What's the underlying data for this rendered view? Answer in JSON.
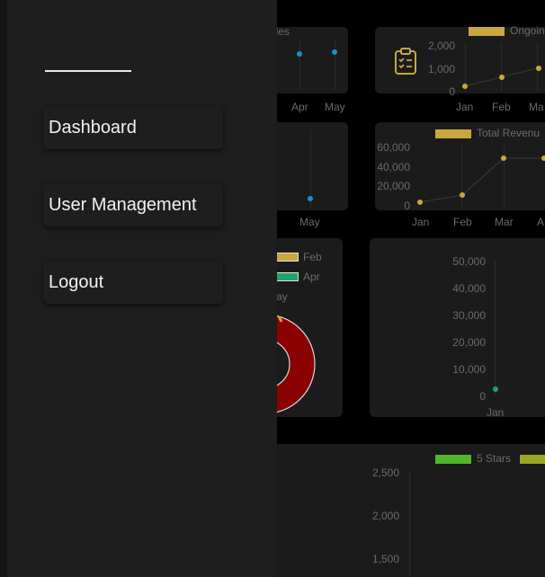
{
  "drawer": {
    "items": [
      {
        "label": "Dashboard"
      },
      {
        "label": "User Management"
      },
      {
        "label": "Logout"
      }
    ]
  },
  "colors": {
    "gold": "#c9a73e",
    "blue": "#1a8fd6",
    "green": "#22a06b",
    "lime": "#52b52a",
    "olive": "#9aa624",
    "donut_red": "#8b0000"
  },
  "icons": {
    "card2": "clipboard-check-icon"
  },
  "chart_data": [
    {
      "type": "line",
      "legend": [
        "ides"
      ],
      "categories": [
        "Apr",
        "May"
      ],
      "series": [
        {
          "name": "ides",
          "values": [
            null,
            null
          ]
        }
      ]
    },
    {
      "type": "line",
      "legend": [
        "Ongoin"
      ],
      "yticks": [
        "2,000",
        "1,000",
        "0"
      ],
      "ylim": [
        0,
        2000
      ],
      "categories": [
        "Jan",
        "Feb",
        "Ma"
      ],
      "series": [
        {
          "name": "Ongoin",
          "values": [
            200,
            600,
            1000
          ]
        }
      ]
    },
    {
      "type": "line",
      "categories": [
        "May"
      ],
      "series": [
        {
          "values": [
            null
          ]
        }
      ]
    },
    {
      "type": "line",
      "legend": [
        "Total Revenu"
      ],
      "yticks": [
        "60,000",
        "40,000",
        "20,000",
        "0"
      ],
      "ylim": [
        0,
        60000
      ],
      "categories": [
        "Jan",
        "Feb",
        "Mar",
        "A"
      ],
      "series": [
        {
          "name": "Total Revenu",
          "values": [
            3000,
            10000,
            48000,
            48000
          ]
        }
      ]
    },
    {
      "type": "pie",
      "legend": [
        "Feb",
        "Apr",
        "ay"
      ]
    },
    {
      "type": "line",
      "yticks": [
        "50,000",
        "40,000",
        "30,000",
        "20,000",
        "10,000",
        "0"
      ],
      "ylim": [
        0,
        50000
      ],
      "categories": [
        "Jan"
      ],
      "series": [
        {
          "values": [
            2500
          ]
        }
      ]
    },
    {
      "type": "bar",
      "legend": [
        "5 Stars"
      ],
      "yticks": [
        "2,500",
        "2,000",
        "1,500"
      ]
    }
  ]
}
